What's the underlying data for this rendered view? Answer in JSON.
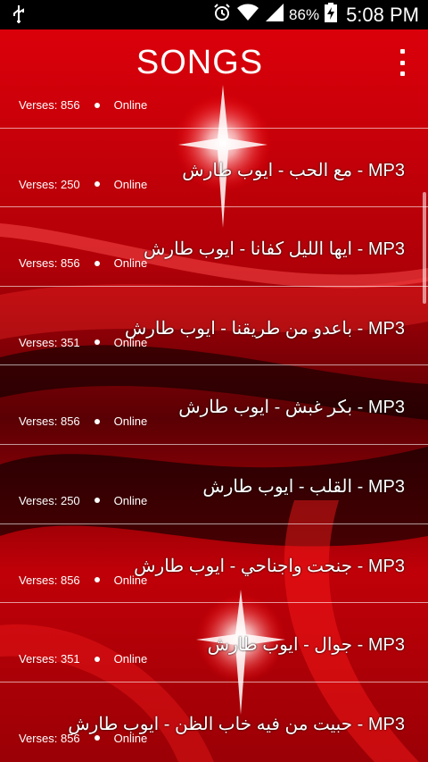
{
  "status_bar": {
    "battery_percent": "86%",
    "time": "5:08 PM",
    "icons": [
      "usb-icon",
      "alarm-icon",
      "wifi-icon",
      "signal-icon",
      "battery-charging-icon"
    ]
  },
  "app_bar": {
    "title": "SONGS",
    "menu_icon": "overflow-menu-icon"
  },
  "songs": [
    {
      "title": "",
      "verses": "Verses: 856",
      "status": "Online"
    },
    {
      "title": "مع الحب - ايوب طارش - MP3",
      "verses": "Verses: 250",
      "status": "Online"
    },
    {
      "title": "ايها الليل كفانا - ايوب طارش - MP3",
      "verses": "Verses: 856",
      "status": "Online"
    },
    {
      "title": "باعدو من طريقنا - ايوب طارش - MP3",
      "verses": "Verses: 351",
      "status": "Online"
    },
    {
      "title": "بكر غبش - ايوب طارش - MP3",
      "verses": "Verses: 856",
      "status": "Online"
    },
    {
      "title": "القلب - ايوب طارش - MP3",
      "verses": "Verses: 250",
      "status": "Online"
    },
    {
      "title": "جنحت واجناحي - ايوب طارش - MP3",
      "verses": "Verses: 856",
      "status": "Online"
    },
    {
      "title": "جوال - ايوب طارش - MP3",
      "verses": "Verses: 351",
      "status": "Online"
    },
    {
      "title": "حبيت من فيه خاب الظن - ايوب طارش - MP3",
      "verses": "Verses: 856",
      "status": "Online"
    }
  ],
  "colors": {
    "background_red": "#c8000a",
    "background_dark": "#000000",
    "text": "#ffffff"
  }
}
